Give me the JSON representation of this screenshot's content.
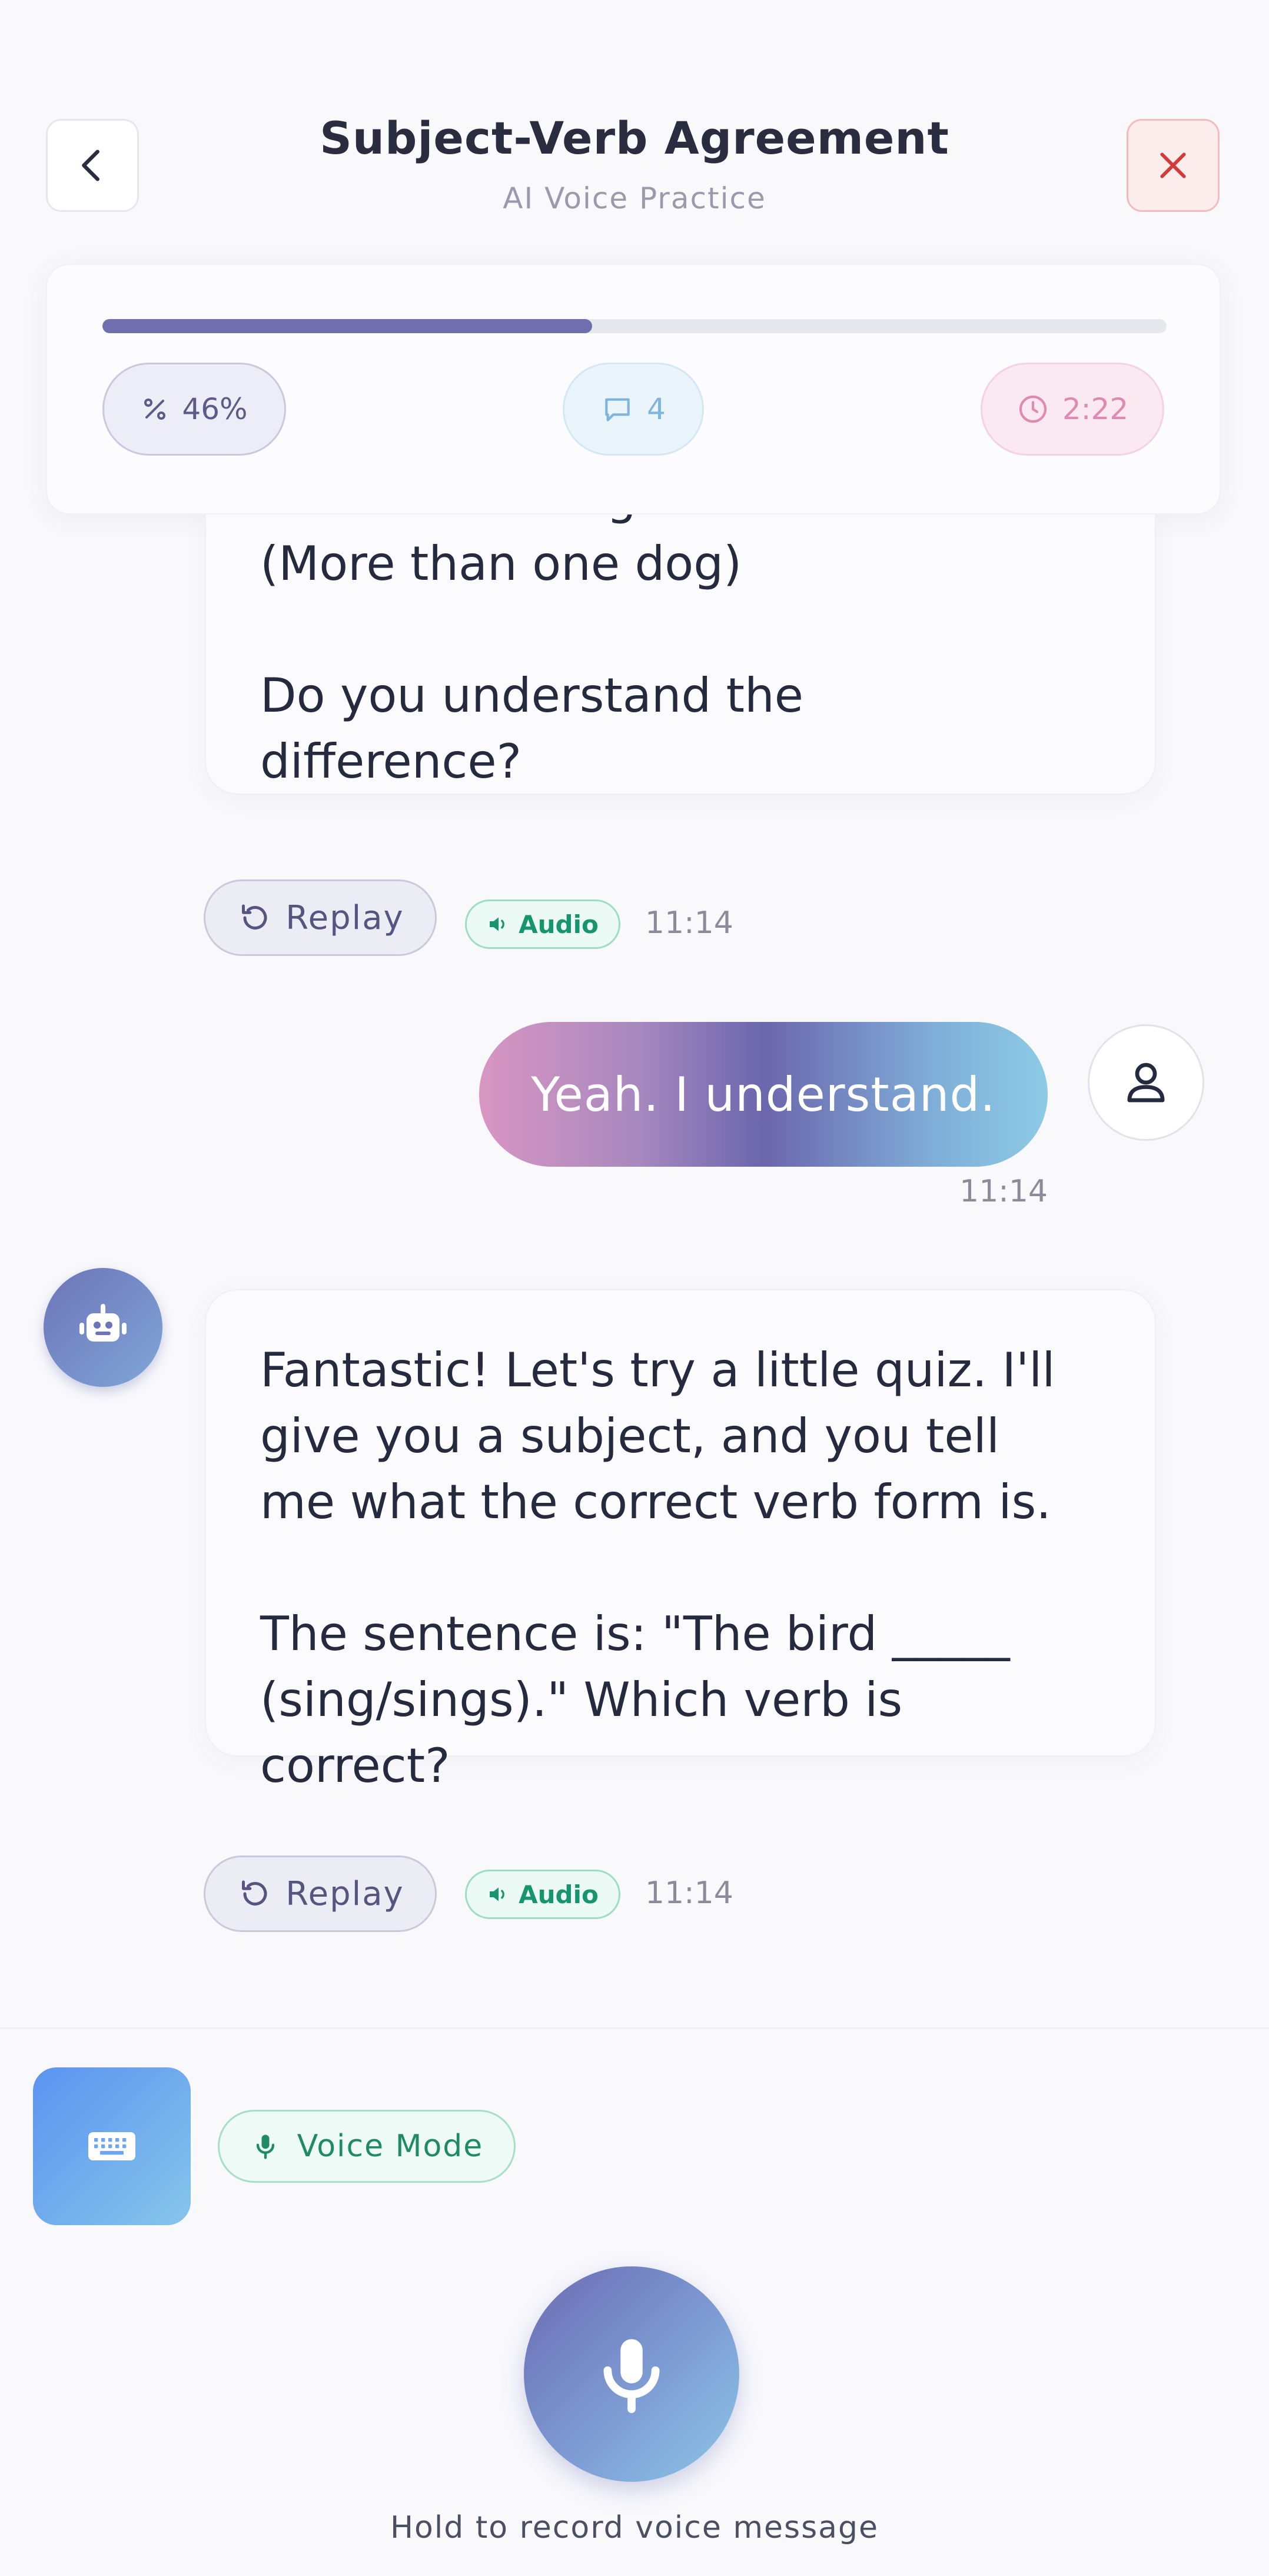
{
  "header": {
    "title": "Subject-Verb Agreement",
    "subtitle": "AI Voice Practice",
    "back_icon": "chevron-left-icon",
    "close_icon": "close-x-icon"
  },
  "progress": {
    "percent_label": "46%",
    "percent_value": 46,
    "messages_count": "4",
    "timer": "2:22"
  },
  "messages": [
    {
      "sender": "ai",
      "text": "Plural: \"The dogs\" bark\".\n(More than one dog)\n\nDo you understand the\ndifference?",
      "replay_label": "Replay",
      "audio_label": "Audio",
      "time": "11:14"
    },
    {
      "sender": "user",
      "text": "Yeah. I understand.",
      "time": "11:14"
    },
    {
      "sender": "ai",
      "text": "Fantastic! Let's try a little quiz. I'll\ngive you a subject, and you tell\nme what the correct verb form is.\n\nThe sentence is: \"The bird _____\n(sing/sings).\" Which verb is\ncorrect?",
      "replay_label": "Replay",
      "audio_label": "Audio",
      "time": "11:14"
    }
  ],
  "input": {
    "keyboard_icon": "keyboard-icon",
    "voice_mode_label": "Voice Mode",
    "hold_hint": "Hold to record voice message"
  },
  "colors": {
    "accent": "#6f6fb0",
    "progress_track": "#e7e7ee",
    "audio_green": "#17956d",
    "timer_pink": "#e089b3",
    "messages_blue": "#7fb4dc",
    "close_red": "#d23b3b"
  }
}
